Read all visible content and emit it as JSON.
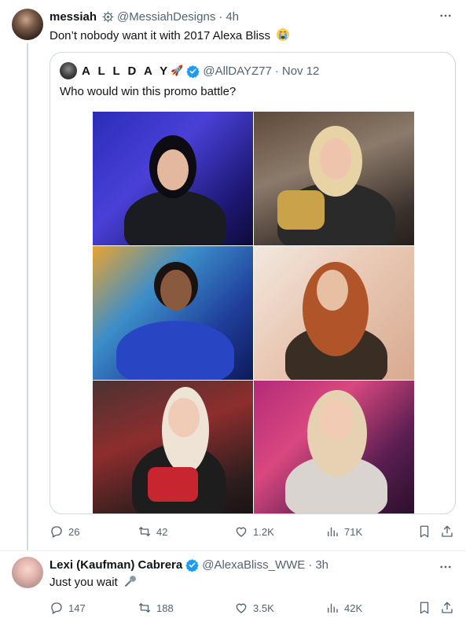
{
  "post": {
    "author_name": "messiah",
    "author_handle": "@MessiahDesigns",
    "time": "4h",
    "text": "Don’t nobody want it with 2017 Alexa Bliss",
    "emoji": "crying-face",
    "stats": {
      "replies": "26",
      "reposts": "42",
      "likes": "1.2K",
      "views": "71K"
    }
  },
  "quote": {
    "author_name": "A L L D A Y",
    "author_emoji": "🚀",
    "author_handle": "@AllDAYZ77",
    "date": "Nov 12",
    "text": "Who would win this promo battle?"
  },
  "reply": {
    "author_name": "Lexi (Kaufman) Cabrera",
    "author_handle": "@AlexaBliss_WWE",
    "time": "3h",
    "text": "Just you wait",
    "emoji": "microphone",
    "stats": {
      "replies": "147",
      "reposts": "188",
      "likes": "3.5K",
      "views": "42K"
    }
  },
  "separator": "·",
  "colors": {
    "text": "#0f1419",
    "secondary": "#536471",
    "border": "#cfd9de",
    "verified": "#1d9bf0"
  }
}
